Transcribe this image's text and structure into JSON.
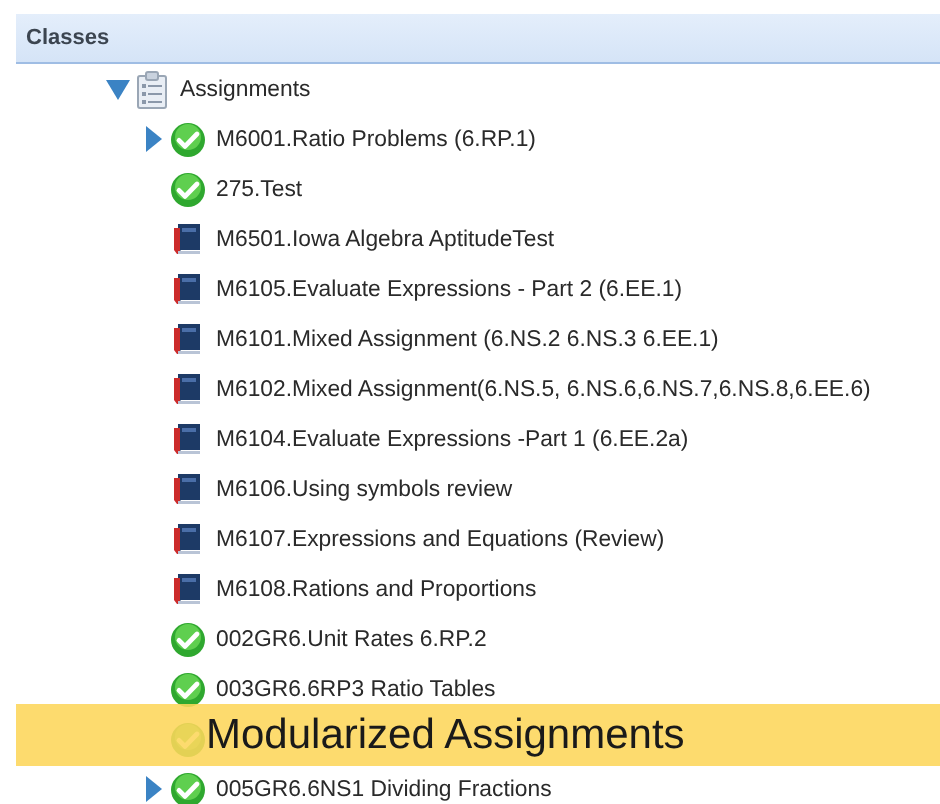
{
  "panel": {
    "title": "Classes"
  },
  "tree": [
    {
      "label": "Assignments",
      "kind": "folder",
      "expanded": true,
      "children": [
        {
          "label": "M6001.Ratio Problems (6.RP.1)",
          "kind": "check",
          "expanded": false
        },
        {
          "label": "275.Test",
          "kind": "check"
        },
        {
          "label": "M6501.Iowa Algebra AptitudeTest",
          "kind": "book"
        },
        {
          "label": "M6105.Evaluate Expressions - Part 2 (6.EE.1)",
          "kind": "book"
        },
        {
          "label": "M6101.Mixed Assignment (6.NS.2 6.NS.3 6.EE.1)",
          "kind": "book"
        },
        {
          "label": "M6102.Mixed Assignment(6.NS.5, 6.NS.6,6.NS.7,6.NS.8,6.EE.6)",
          "kind": "book"
        },
        {
          "label": "M6104.Evaluate Expressions -Part 1 (6.EE.2a)",
          "kind": "book"
        },
        {
          "label": "M6106.Using symbols review",
          "kind": "book"
        },
        {
          "label": "M6107.Expressions and Equations (Review)",
          "kind": "book"
        },
        {
          "label": "M6108.Rations and Proportions",
          "kind": "book"
        },
        {
          "label": "002GR6.Unit Rates 6.RP.2",
          "kind": "check"
        },
        {
          "label": "003GR6.6RP3 Ratio Tables",
          "kind": "check"
        },
        {
          "kind": "check"
        },
        {
          "label": "005GR6.6NS1 Dividing Fractions",
          "kind": "check",
          "expanded": false
        }
      ]
    }
  ],
  "caption": "Modularized Assignments"
}
